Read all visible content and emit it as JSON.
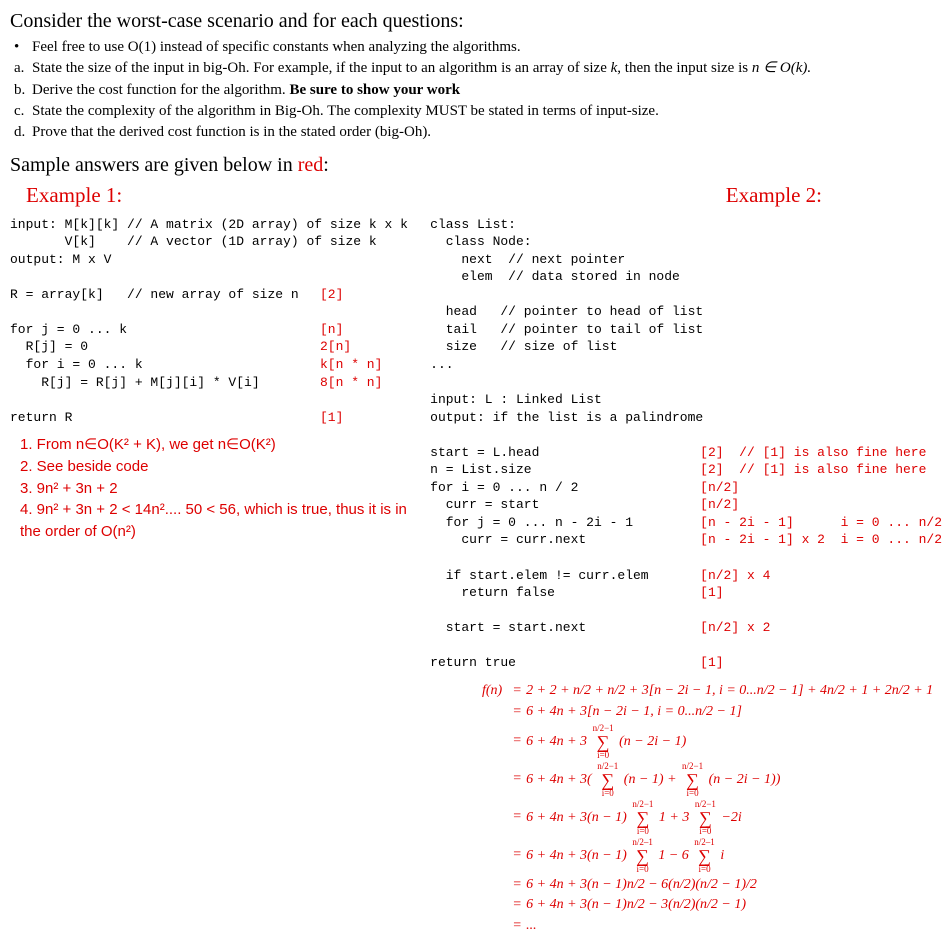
{
  "heading": "Consider the worst-case scenario and for each questions:",
  "intro_bullet": "Feel free to use O(1) instead of specific constants when analyzing the algorithms.",
  "items": {
    "a_pre": "State the size of the input in big-Oh. For example, if the input to an algorithm is an array of size ",
    "a_mid": "k",
    "a_post1": ", then the input size is ",
    "a_post2": "n ∈ O(k).",
    "b_pre": "Derive the cost function for the algorithm. ",
    "b_bold": "Be sure to show your work",
    "c": "State the complexity of the algorithm in Big-Oh. The complexity MUST be stated in terms of input-size.",
    "d": "Prove that the derived cost function is in the stated order (big-Oh)."
  },
  "sample_pre": "Sample answers are given below in ",
  "sample_red": "red",
  "sample_post": ":",
  "ex1_label": "Example 1:",
  "ex2_label": "Example 2:",
  "ex1_code": [
    {
      "c": "input: M[k][k] // A matrix (2D array) of size k x k",
      "a": ""
    },
    {
      "c": "       V[k]    // A vector (1D array) of size k",
      "a": ""
    },
    {
      "c": "output: M x V",
      "a": ""
    },
    {
      "c": "",
      "a": ""
    },
    {
      "c": "R = array[k]   // new array of size n",
      "a": "[2]"
    },
    {
      "c": "",
      "a": ""
    },
    {
      "c": "for j = 0 ... k",
      "a": "[n]"
    },
    {
      "c": "  R[j] = 0",
      "a": "2[n]"
    },
    {
      "c": "  for i = 0 ... k",
      "a": "k[n * n]"
    },
    {
      "c": "    R[j] = R[j] + M[j][i] * V[i]",
      "a": "8[n * n]"
    },
    {
      "c": "",
      "a": ""
    },
    {
      "c": "return R",
      "a": "[1]"
    }
  ],
  "ex1_answers": {
    "l1": "1. From n∈O(K² + K), we get n∈O(K²)",
    "l2": "2. See beside code",
    "l3": "3. 9n² + 3n + 2",
    "l4": "4. 9n² + 3n + 2 < 14n².... 50 < 56, which is true, thus it is in the order of O(n²)"
  },
  "ex2_code_top": [
    "class List:",
    "  class Node:",
    "    next  // next pointer",
    "    elem  // data stored in node",
    "",
    "  head   // pointer to head of list",
    "  tail   // pointer to tail of list",
    "  size   // size of list",
    "...",
    "",
    "input: L : Linked List",
    "output: if the list is a palindrome",
    ""
  ],
  "ex2_code_ann": [
    {
      "c": "start = L.head",
      "a": "[2]  // [1] is also fine here"
    },
    {
      "c": "n = List.size",
      "a": "[2]  // [1] is also fine here"
    },
    {
      "c": "for i = 0 ... n / 2",
      "a": "[n/2]"
    },
    {
      "c": "  curr = start",
      "a": "[n/2]"
    },
    {
      "c": "  for j = 0 ... n - 2i - 1",
      "a": "[n - 2i - 1]      i = 0 ... n/2"
    },
    {
      "c": "    curr = curr.next",
      "a": "[n - 2i - 1] x 2  i = 0 ... n/2"
    },
    {
      "c": "",
      "a": ""
    },
    {
      "c": "  if start.elem != curr.elem",
      "a": "[n/2] x 4"
    },
    {
      "c": "    return false",
      "a": "[1]"
    },
    {
      "c": "",
      "a": ""
    },
    {
      "c": "  start = start.next",
      "a": "[n/2] x 2"
    },
    {
      "c": "",
      "a": ""
    },
    {
      "c": "return true",
      "a": "[1]"
    }
  ],
  "math": {
    "lhs": "f(n)",
    "r1": "2 + 2 + n/2 + n/2 + 3[n − 2i − 1, i = 0...n/2 − 1] + 4n/2 + 1 + 2n/2 + 1",
    "r2": "6 + 4n + 3[n − 2i − 1, i = 0...n/2 − 1]",
    "r3_pre": "6 + 4n + 3",
    "r3_term": "(n − 2i − 1)",
    "r4_pre": "6 + 4n + 3(",
    "r4_t1": "(n − 1)",
    "r4_plus": " + ",
    "r4_t2": "(n − 2i − 1))",
    "r5_pre": "6 + 4n + 3(n − 1)",
    "r5_t1": "1",
    "r5_mid": " + 3",
    "r5_t2": "−2i",
    "r6_pre": "6 + 4n + 3(n − 1)",
    "r6_t1": "1",
    "r6_mid": " − 6",
    "r6_t2": "i",
    "r7": "6 + 4n + 3(n − 1)n/2 − 6(n/2)(n/2 − 1)/2",
    "r8": "6 + 4n + 3(n − 1)n/2 − 3(n/2)(n/2 − 1)",
    "r9": "...",
    "sum_top_a": "n/2−1",
    "sum_top_b": "n/2–1",
    "sum_bot": "i=0"
  }
}
